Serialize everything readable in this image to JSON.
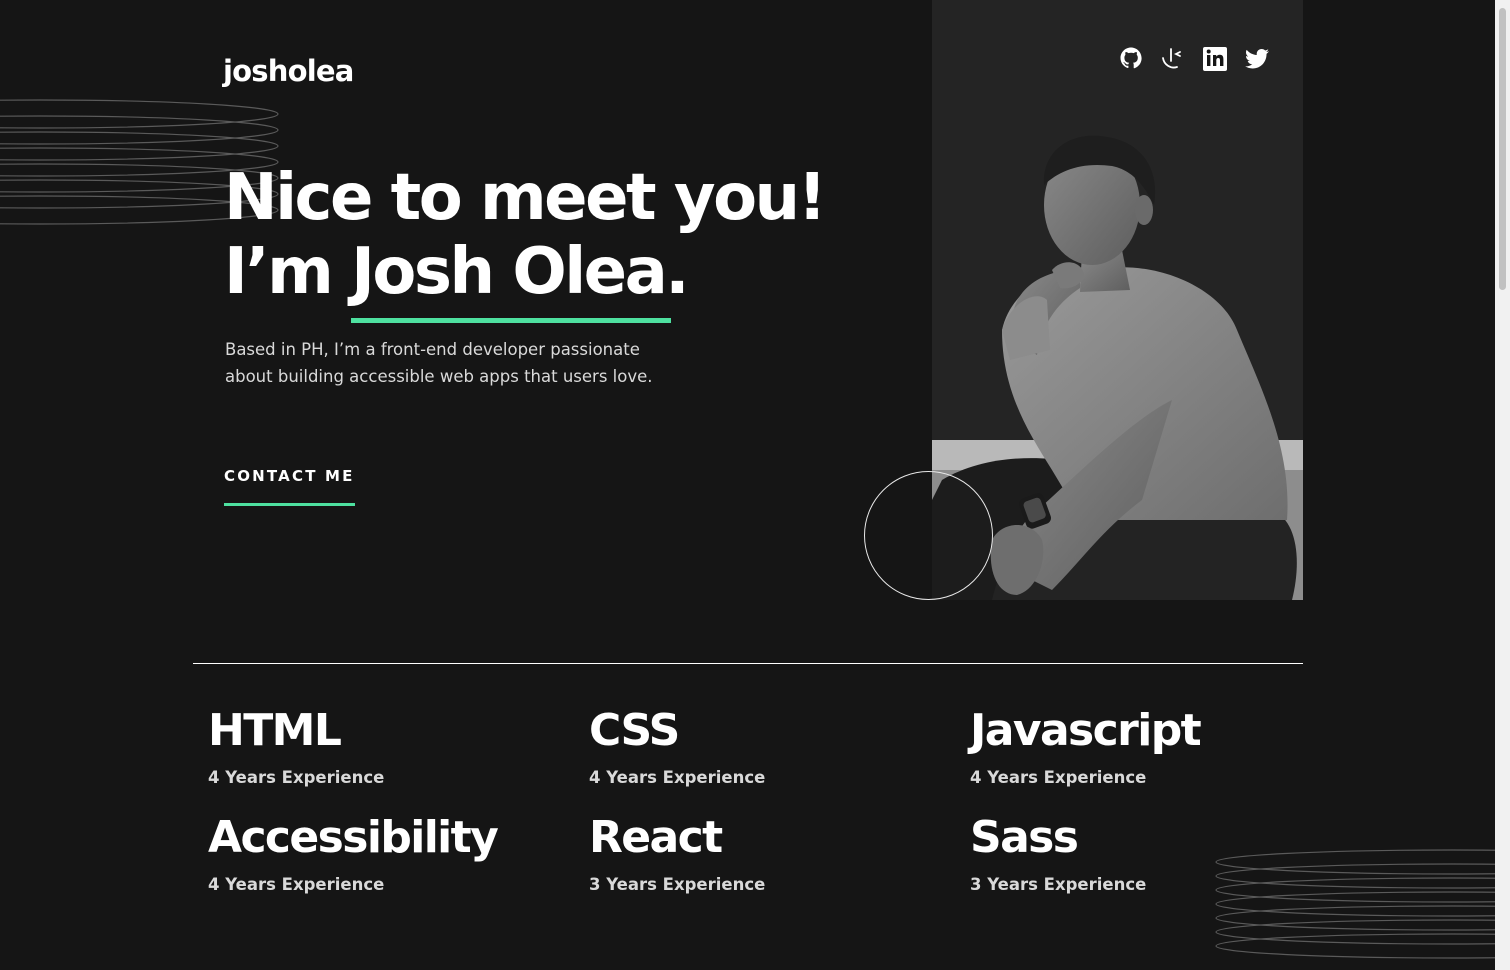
{
  "header": {
    "logo": "josholea",
    "social": [
      {
        "name": "github-link",
        "icon": "github-icon"
      },
      {
        "name": "frontend-mentor-link",
        "icon": "frontend-mentor-icon"
      },
      {
        "name": "linkedin-link",
        "icon": "linkedin-icon"
      },
      {
        "name": "twitter-link",
        "icon": "twitter-icon"
      }
    ]
  },
  "hero": {
    "heading_line1": "Nice to meet you!",
    "heading_line2_prefix": "I’m ",
    "heading_name": "Josh Olea.",
    "description": "Based in PH, I’m a front-end developer passionate about building accessible web apps that users love.",
    "cta_label": "CONTACT ME",
    "photo_icon": "portrait-photo"
  },
  "skills": [
    {
      "name": "HTML",
      "experience": "4 Years Experience"
    },
    {
      "name": "CSS",
      "experience": "4 Years Experience"
    },
    {
      "name": "Javascript",
      "experience": "4 Years Experience"
    },
    {
      "name": "Accessibility",
      "experience": "4 Years Experience"
    },
    {
      "name": "React",
      "experience": "3 Years Experience"
    },
    {
      "name": "Sass",
      "experience": "3 Years Experience"
    }
  ],
  "colors": {
    "background": "#151515",
    "panel": "#242424",
    "accent": "#4ee1a0",
    "text": "#ffffff",
    "muted_text": "#d9d9d9"
  }
}
